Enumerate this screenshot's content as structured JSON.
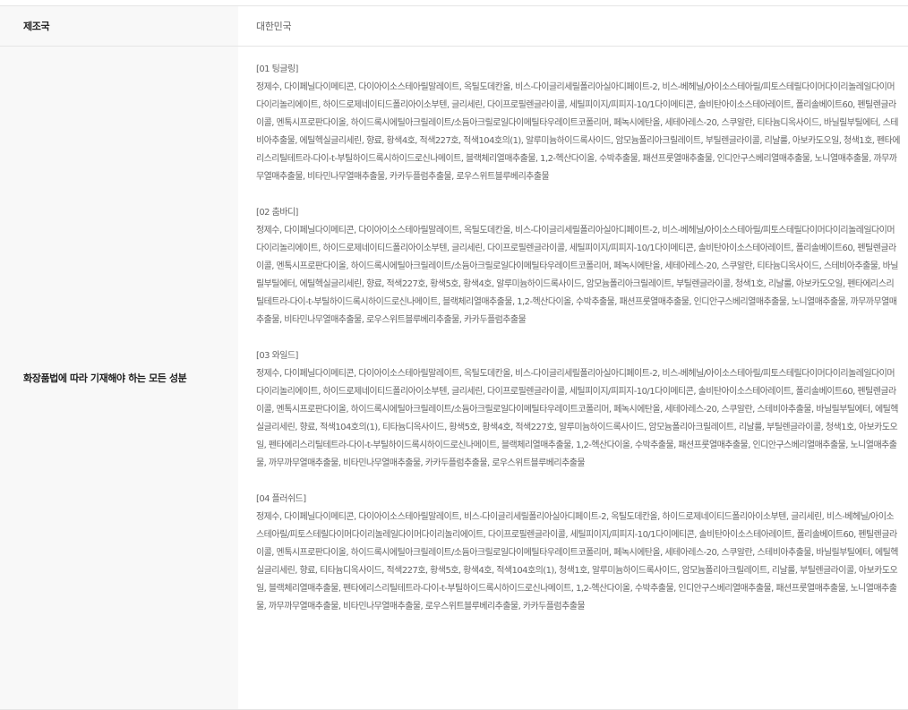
{
  "rows": {
    "country": {
      "label": "제조국",
      "value": "대한민국"
    },
    "ingredients": {
      "label": "화장품법에 따라 기재해야 하는 모든 성분",
      "variants": [
        {
          "title": "[01 팅글링]",
          "body": "정제수, 다이페닐다이메티콘, 다이아이소스테아릴말레이트, 옥틸도데칸올, 비스-다이글리세릴폴리아실아디페이트-2, 비스-베헤닐/아이소스테아릴/피토스테릴다이머다이리놀레일다이머다이리놀리에이트, 하이드로제네이티드폴리아이소부텐, 글리세린, 다이프로필렌글라이콜, 세틸피이지/피피지-10/1다이메티콘, 솔비탄아이소스테아레이트, 폴리솔베이트60, 펜틸렌글라이콜, 멘톡시프로판다이올, 하이드록시에틸아크릴레이트/소듐아크릴로일다이메틸타우레이트코폴리머, 페녹시에탄올, 세테아레스-20, 스쿠알란, 티타늄디옥사이드, 바닐릴부틸에터, 스테비아추출물, 에틸헥실글리세린, 향료, 황색4호, 적색227호, 적색104호의(1), 알루미늄하이드록사이드, 암모늄폴리아크릴레이트, 부틸렌글라이콜, 리날룰, 아보카도오일, 청색1호, 펜타에리스리틸테트라-다이-t-부틸하이드록시하이드로신나메이트, 블랙체리열매추출물, 1,2-헥산다이올, 수박추출물, 패션프룻열매추출물, 인디안구스베리열매추출물, 노니열매추출물, 까무까무열매추출물, 비타민나무열매추출물, 카카두플럼추출물, 로우스위트블루베리추출물"
        },
        {
          "title": "[02 춤바디]",
          "body": "정제수, 다이페닐다이메티콘, 다이아이소스테아릴말레이트, 옥틸도데칸올, 비스-다이글리세릴폴리아실아디페이트-2, 비스-베헤닐/아이소스테아릴/피토스테릴다이머다이리놀레일다이머다이리놀리에이트, 하이드로제네이티드폴리아이소부텐, 글리세린, 다이프로필렌글라이콜, 세틸피이지/피피지-10/1다이메티콘, 솔비탄아이소스테아레이트, 폴리솔베이트60, 펜틸렌글라이콜, 멘톡시프로판다이올, 하이드록시에틸아크릴레이트/소듐아크릴로일다이메틸타우레이트코폴리머, 페녹시에탄올, 세테아레스-20, 스쿠알란, 티타늄디옥사이드, 스테비아추출물, 바닐릴부틸에터, 에틸헥실글리세린, 향료, 적색227호, 황색5호, 황색4호, 알루미늄하이드록사이드, 암모늄폴리아크릴레이트, 부틸렌글라이콜, 청색1호, 리날룰, 아보카도오일, 펜타에리스리틸테트라-다이-t-부틸하이드록시하이드로신나메이트, 블랙체리열매추출물, 1,2-헥산다이올, 수박추출물, 패션프룻열매추출물, 인디안구스베리열매추출물, 노니열매추출물, 까무까무열매추출물, 비타민나무열매추출물, 로우스위트블루베리추출물, 카카두플럼추출물"
        },
        {
          "title": "[03 와일드]",
          "body": "정제수, 다이페닐다이메티콘, 다이아이소스테아릴말레이트, 옥틸도데칸올, 비스-다이글리세릴폴리아실아디페이트-2, 비스-베헤닐/아이소스테아릴/피토스테릴다이머다이리놀레일다이머다이리놀리에이트, 하이드로제네이티드폴리아이소부텐, 글리세린, 다이프로필렌글라이콜, 세틸피이지/피피지-10/1다이메티콘, 솔비탄아이소스테아레이트, 폴리솔베이트60, 펜틸렌글라이콜, 멘톡시프로판다이올, 하이드록시에틸아크릴레이트/소듐아크릴로일다이메틸타우레이트코폴리머, 페녹시에탄올, 세테아레스-20, 스쿠알란, 스테비아추출물, 바닐릴부틸에터, 에틸헥실글리세린, 향료, 적색104호의(1), 티타늄디옥사이드, 황색5호, 황색4호, 적색227호, 알루미늄하이드록사이드, 암모늄폴리아크릴레이트, 리날룰, 부틸렌글라이콜, 청색1호, 아보카도오일, 펜타에리스리틸테트라-다이-t-부틸하이드록시하이드로신나메이트, 블랙체리열매추출물, 1,2-헥산다이올, 수박추출물, 패션프룻열매추출물, 인디안구스베리열매추출물, 노니열매추출물, 까무까무열매추출물, 비타민나무열매추출물, 카카두플럼추출물, 로우스위트블루베리추출물"
        },
        {
          "title": "[04 플러쉬드]",
          "body": "정제수, 다이페닐다이메티콘, 다이아이소스테아릴말레이트, 비스-다이글리세릴폴리아실아디페이트-2, 옥틸도데칸올, 하이드로제네이티드폴리아이소부텐, 글리세린, 비스-베헤닐/아이소스테아릴/피토스테릴다이머다이리놀레일다이머다이리놀리에이트, 다이프로필렌글라이콜, 세틸피이지/피피지-10/1다이메티콘, 솔비탄아이소스테아레이트, 폴리솔베이트60, 펜틸렌글라이콜, 멘톡시프로판다이올, 하이드록시에틸아크릴레이트/소듐아크릴로일다이메틸타우레이트코폴리머, 페녹시에탄올, 세테아레스-20, 스쿠알란, 스테비아추출물, 바닐릴부틸에터, 에틸헥실글리세린, 향료, 티타늄디옥사이드, 적색227호, 황색5호, 황색4호, 적색104호의(1), 청색1호, 알루미늄하이드록사이드, 암모늄폴리아크릴레이트, 리날룰, 부틸렌글라이콜, 아보카도오일, 블랙체리열매추출물, 펜타에리스리틸테트라-다이-t-부틸하이드록시하이드로신나메이트, 1,2-헥산다이올, 수박추출물, 인디안구스베리열매추출물, 패션프룻열매추출물, 노니열매추출물, 까무까무열매추출물, 비타민나무열매추출물, 로우스위트블루베리추출물, 카카두플럼추출물"
        }
      ]
    }
  }
}
